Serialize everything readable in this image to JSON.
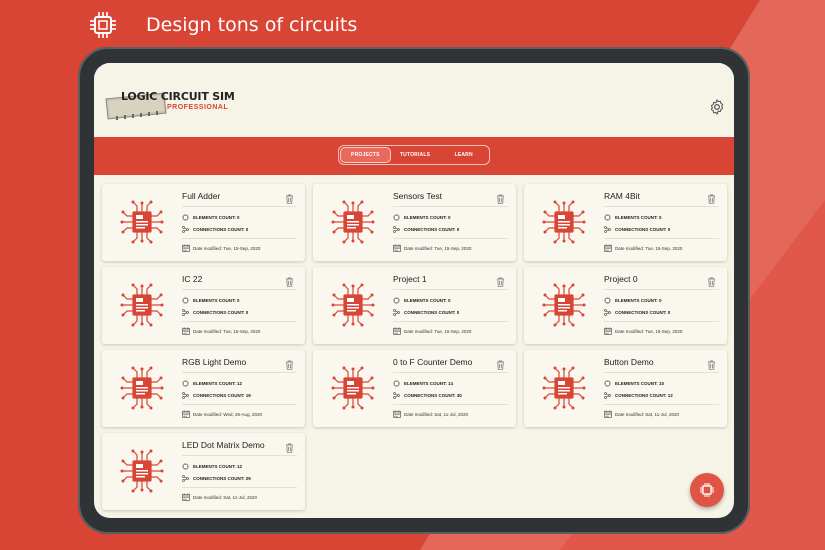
{
  "promo": {
    "text": "Design tons of circuits",
    "icon": "chip-icon"
  },
  "app": {
    "logo_title": "LOGIC CIRCUIT SIM",
    "logo_subtitle": "PROFESSIONAL",
    "settings_icon": "gear-icon"
  },
  "tabs": [
    {
      "label": "PROJECTS",
      "active": true
    },
    {
      "label": "TUTORIALS",
      "active": false
    },
    {
      "label": "LEARN",
      "active": false
    }
  ],
  "labels": {
    "elements": "ELEMENTS COUNT:",
    "connections": "CONNECTIONS COUNT:",
    "date": "Date modified:"
  },
  "projects": [
    {
      "title": "Full Adder",
      "elements": "0",
      "connections": "0",
      "date": "Tue, 15-Sep, 2020"
    },
    {
      "title": "Sensors Test",
      "elements": "0",
      "connections": "0",
      "date": "Tue, 15-Sep, 2020"
    },
    {
      "title": "RAM 4Bit",
      "elements": "0",
      "connections": "0",
      "date": "Tue, 15-Sep, 2020"
    },
    {
      "title": "IC 22",
      "elements": "0",
      "connections": "0",
      "date": "Tue, 15-Sep, 2020"
    },
    {
      "title": "Project 1",
      "elements": "0",
      "connections": "0",
      "date": "Tue, 15-Sep, 2020"
    },
    {
      "title": "Project 0",
      "elements": "0",
      "connections": "0",
      "date": "Tue, 15-Sep, 2020"
    },
    {
      "title": "RGB Light Demo",
      "elements": "12",
      "connections": "19",
      "date": "Wed, 26-Aug, 2020"
    },
    {
      "title": "0 to F Counter Demo",
      "elements": "14",
      "connections": "30",
      "date": "Sat, 11-Jul, 2020"
    },
    {
      "title": "Button Demo",
      "elements": "10",
      "connections": "12",
      "date": "Sat, 11-Jul, 2020"
    },
    {
      "title": "LED Dot Matrix Demo",
      "elements": "12",
      "connections": "29",
      "date": "Sat, 11-Jul, 2020"
    }
  ],
  "colors": {
    "accent": "#d94535",
    "background": "#f6f3e7",
    "card": "#f9f7ee"
  }
}
